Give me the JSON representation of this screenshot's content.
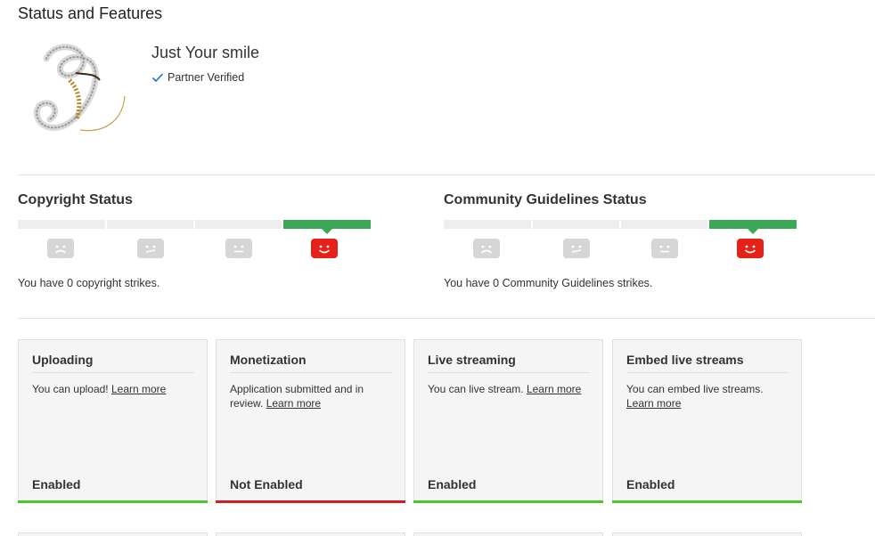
{
  "page": {
    "title": "Status and Features"
  },
  "channel": {
    "name": "Just Your smile",
    "verified_label": "Partner Verified",
    "avatar_icon": "letter-x-pendant-avatar"
  },
  "copyright": {
    "title": "Copyright Status",
    "strikes_text": "You have 0 copyright strikes.",
    "strike_count": 0,
    "levels": [
      "sad-face-icon",
      "meh-face-icon",
      "neutral-face-icon",
      "happy-face-icon"
    ],
    "active_level": 3
  },
  "community": {
    "title": "Community Guidelines Status",
    "strikes_text": "You have 0 Community Guidelines strikes.",
    "strike_count": 0,
    "levels": [
      "sad-face-icon",
      "meh-face-icon",
      "neutral-face-icon",
      "happy-face-icon"
    ],
    "active_level": 3
  },
  "features": [
    {
      "title": "Uploading",
      "desc": "You can upload! ",
      "link": "Learn more",
      "status": "Enabled",
      "enabled": true
    },
    {
      "title": "Monetization",
      "desc": "Application submitted and in review. ",
      "link": "Learn more",
      "status": "Not Enabled",
      "enabled": false
    },
    {
      "title": "Live streaming",
      "desc": "You can live stream. ",
      "link": "Learn more",
      "status": "Enabled",
      "enabled": true
    },
    {
      "title": "Embed live streams",
      "desc": "You can embed live streams. ",
      "link": "Learn more",
      "status": "Enabled",
      "enabled": true
    }
  ],
  "colors": {
    "enabled": "#4cc52b",
    "not_enabled": "#cc2124",
    "standing_good": "#3aa854",
    "face_active": "#e62117"
  }
}
